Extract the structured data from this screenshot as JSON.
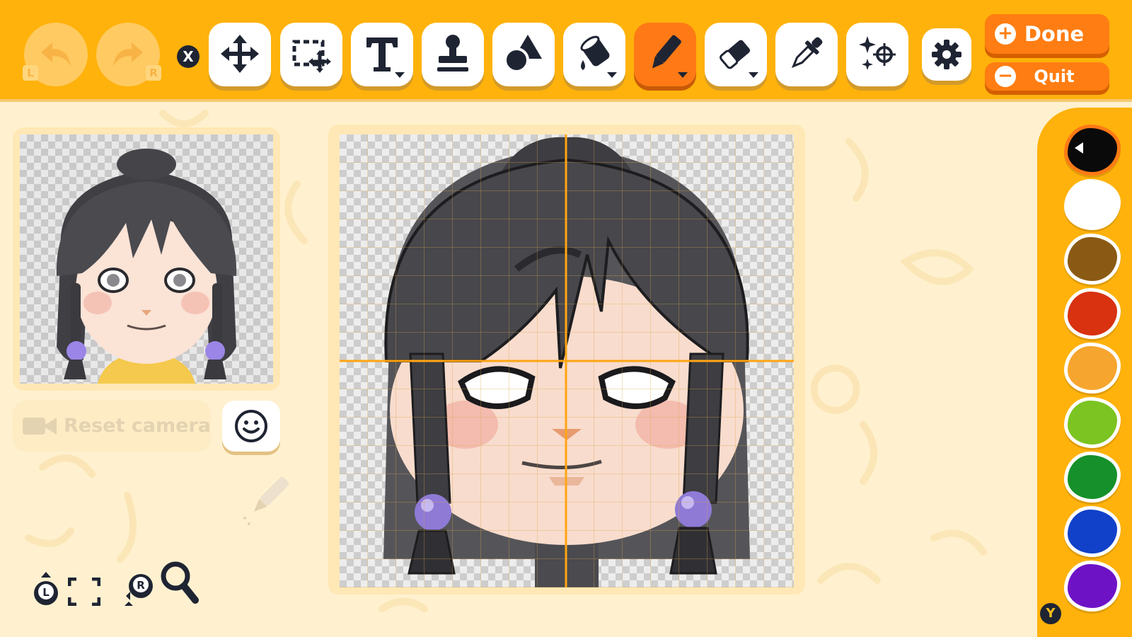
{
  "toolbar": {
    "undo": {
      "badge": "L"
    },
    "redo": {
      "badge": "R"
    },
    "close_badge": "X",
    "tools": [
      {
        "name": "move-tool",
        "icon": "move-arrows-icon",
        "has_dropdown": false
      },
      {
        "name": "select-tool",
        "icon": "marquee-select-icon",
        "has_dropdown": false
      },
      {
        "name": "text-tool",
        "icon": "text-t-icon",
        "has_dropdown": true
      },
      {
        "name": "stamp-tool",
        "icon": "stamp-icon",
        "has_dropdown": false
      },
      {
        "name": "shape-tool",
        "icon": "shapes-icon",
        "has_dropdown": false
      },
      {
        "name": "fill-tool",
        "icon": "paint-bucket-icon",
        "has_dropdown": true
      },
      {
        "name": "pen-tool",
        "icon": "pen-icon",
        "has_dropdown": true,
        "active": true
      },
      {
        "name": "eraser-tool",
        "icon": "eraser-icon",
        "has_dropdown": true
      },
      {
        "name": "eyedropper-tool",
        "icon": "eyedropper-icon",
        "has_dropdown": false
      },
      {
        "name": "effects-tool",
        "icon": "sparkle-target-icon",
        "has_dropdown": false
      }
    ],
    "settings_icon": "gear-icon",
    "done": {
      "label": "Done",
      "symbol": "+"
    },
    "quit": {
      "label": "Quit",
      "symbol": "−"
    }
  },
  "preview": {
    "reset_camera_label": "Reset camera",
    "face_button_icon": "smiley-face-icon"
  },
  "bottom_controls": {
    "left_stick_badge": "L",
    "right_stick_badge": "R",
    "icons": [
      "left-stick-icon",
      "fullscreen-bracket-icon",
      "right-stick-icon",
      "zoom-magnifier-icon"
    ]
  },
  "palette": {
    "swatches": [
      {
        "color": "#0a0a0a",
        "selected": true
      },
      {
        "color": "#ffffff"
      },
      {
        "color": "#8a5a14"
      },
      {
        "color": "#d83210"
      },
      {
        "color": "#f6a52e"
      },
      {
        "color": "#7cc421"
      },
      {
        "color": "#16902a"
      },
      {
        "color": "#1041c8"
      },
      {
        "color": "#6e12c6"
      }
    ],
    "y_badge": "Y"
  },
  "colors": {
    "toolbar_bg": "#ffb20b",
    "accent_orange": "#ff7d12",
    "page_bg": "#fff1cf"
  }
}
